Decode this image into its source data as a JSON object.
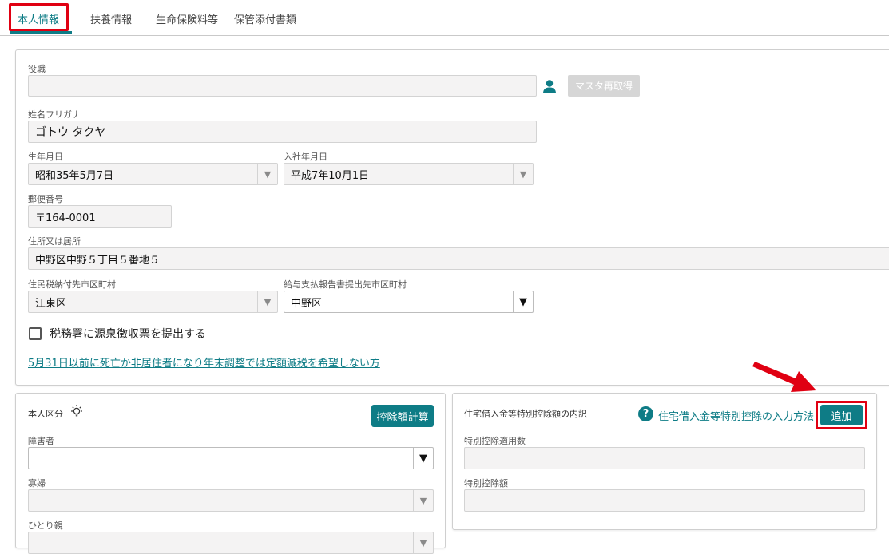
{
  "tabs": [
    {
      "label": "本人情報"
    },
    {
      "label": "扶養情報"
    },
    {
      "label": "生命保険料等"
    },
    {
      "label": "保管添付書類"
    }
  ],
  "personal": {
    "position_label": "役職",
    "position_value": "",
    "master_button": "マスタ再取得",
    "kana_label": "姓名フリガナ",
    "kana_value": "ゴトウ タクヤ",
    "birth_label": "生年月日",
    "birth_value": "昭和35年5月7日",
    "hire_label": "入社年月日",
    "hire_value": "平成7年10月1日",
    "postal_label": "郵便番号",
    "postal_value": "〒164-0001",
    "address_label": "住所又は居所",
    "address_value": "中野区中野５丁目５番地５",
    "resident_tax_label": "住民税納付先市区町村",
    "resident_tax_value": "江東区",
    "payment_report_label": "給与支払報告書提出先市区町村",
    "payment_report_value": "中野区",
    "submit_checkbox_label": "税務署に源泉徴収票を提出する",
    "death_link": "5月31日以前に死亡か非居住者になり年末調整では定額減税を希望しない方"
  },
  "deduction": {
    "title": "本人区分",
    "calc_button": "控除額計算",
    "disability_label": "障害者",
    "disability_value": "",
    "widow_label": "寡婦",
    "widow_value": "",
    "single_parent_label": "ひとり親"
  },
  "housing": {
    "title": "住宅借入金等特別控除額の内訳",
    "help_link": "住宅借入金等特別控除の入力方法",
    "add_button": "追加",
    "count_label": "特別控除適用数",
    "count_value": "",
    "amount_label": "特別控除額",
    "amount_value": ""
  },
  "colors": {
    "accent": "#0e7c86",
    "highlight": "#e00012",
    "field_bg": "#f4f3f3"
  }
}
